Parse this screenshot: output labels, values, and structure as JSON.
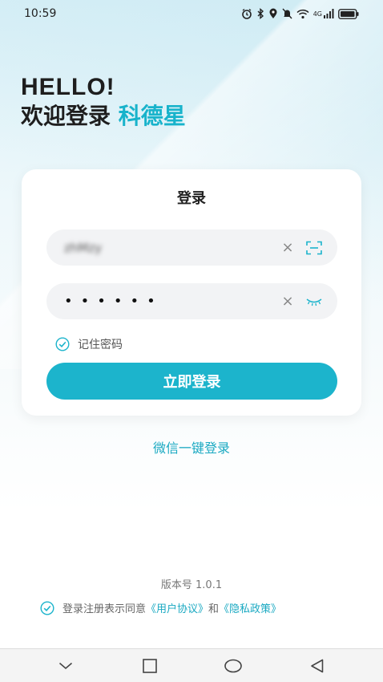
{
  "status_bar": {
    "time": "10:59",
    "network": "4G"
  },
  "greeting": {
    "hello": "HELLO!",
    "welcome_prefix": "欢迎登录",
    "brand_name": "科德星"
  },
  "login_card": {
    "title": "登录",
    "username": {
      "value": "zhMzy",
      "blurred": true
    },
    "password": {
      "masked_value": "••••••"
    },
    "remember_password": {
      "label": "记住密码",
      "checked": true
    },
    "login_button_label": "立即登录"
  },
  "wechat_login_label": "微信一键登录",
  "version_text": "版本号 1.0.1",
  "agreement": {
    "checked": true,
    "prefix": "登录注册表示同意",
    "user_agreement": "《用户协议》",
    "conjunction": "和",
    "privacy_policy": "《隐私政策》"
  },
  "colors": {
    "accent": "#1cb4cc",
    "link": "#1aa9c2"
  },
  "icons": {
    "clear": "close-icon",
    "scan": "scan-icon",
    "eye": "eye-closed-icon",
    "check": "check-circle-icon"
  }
}
